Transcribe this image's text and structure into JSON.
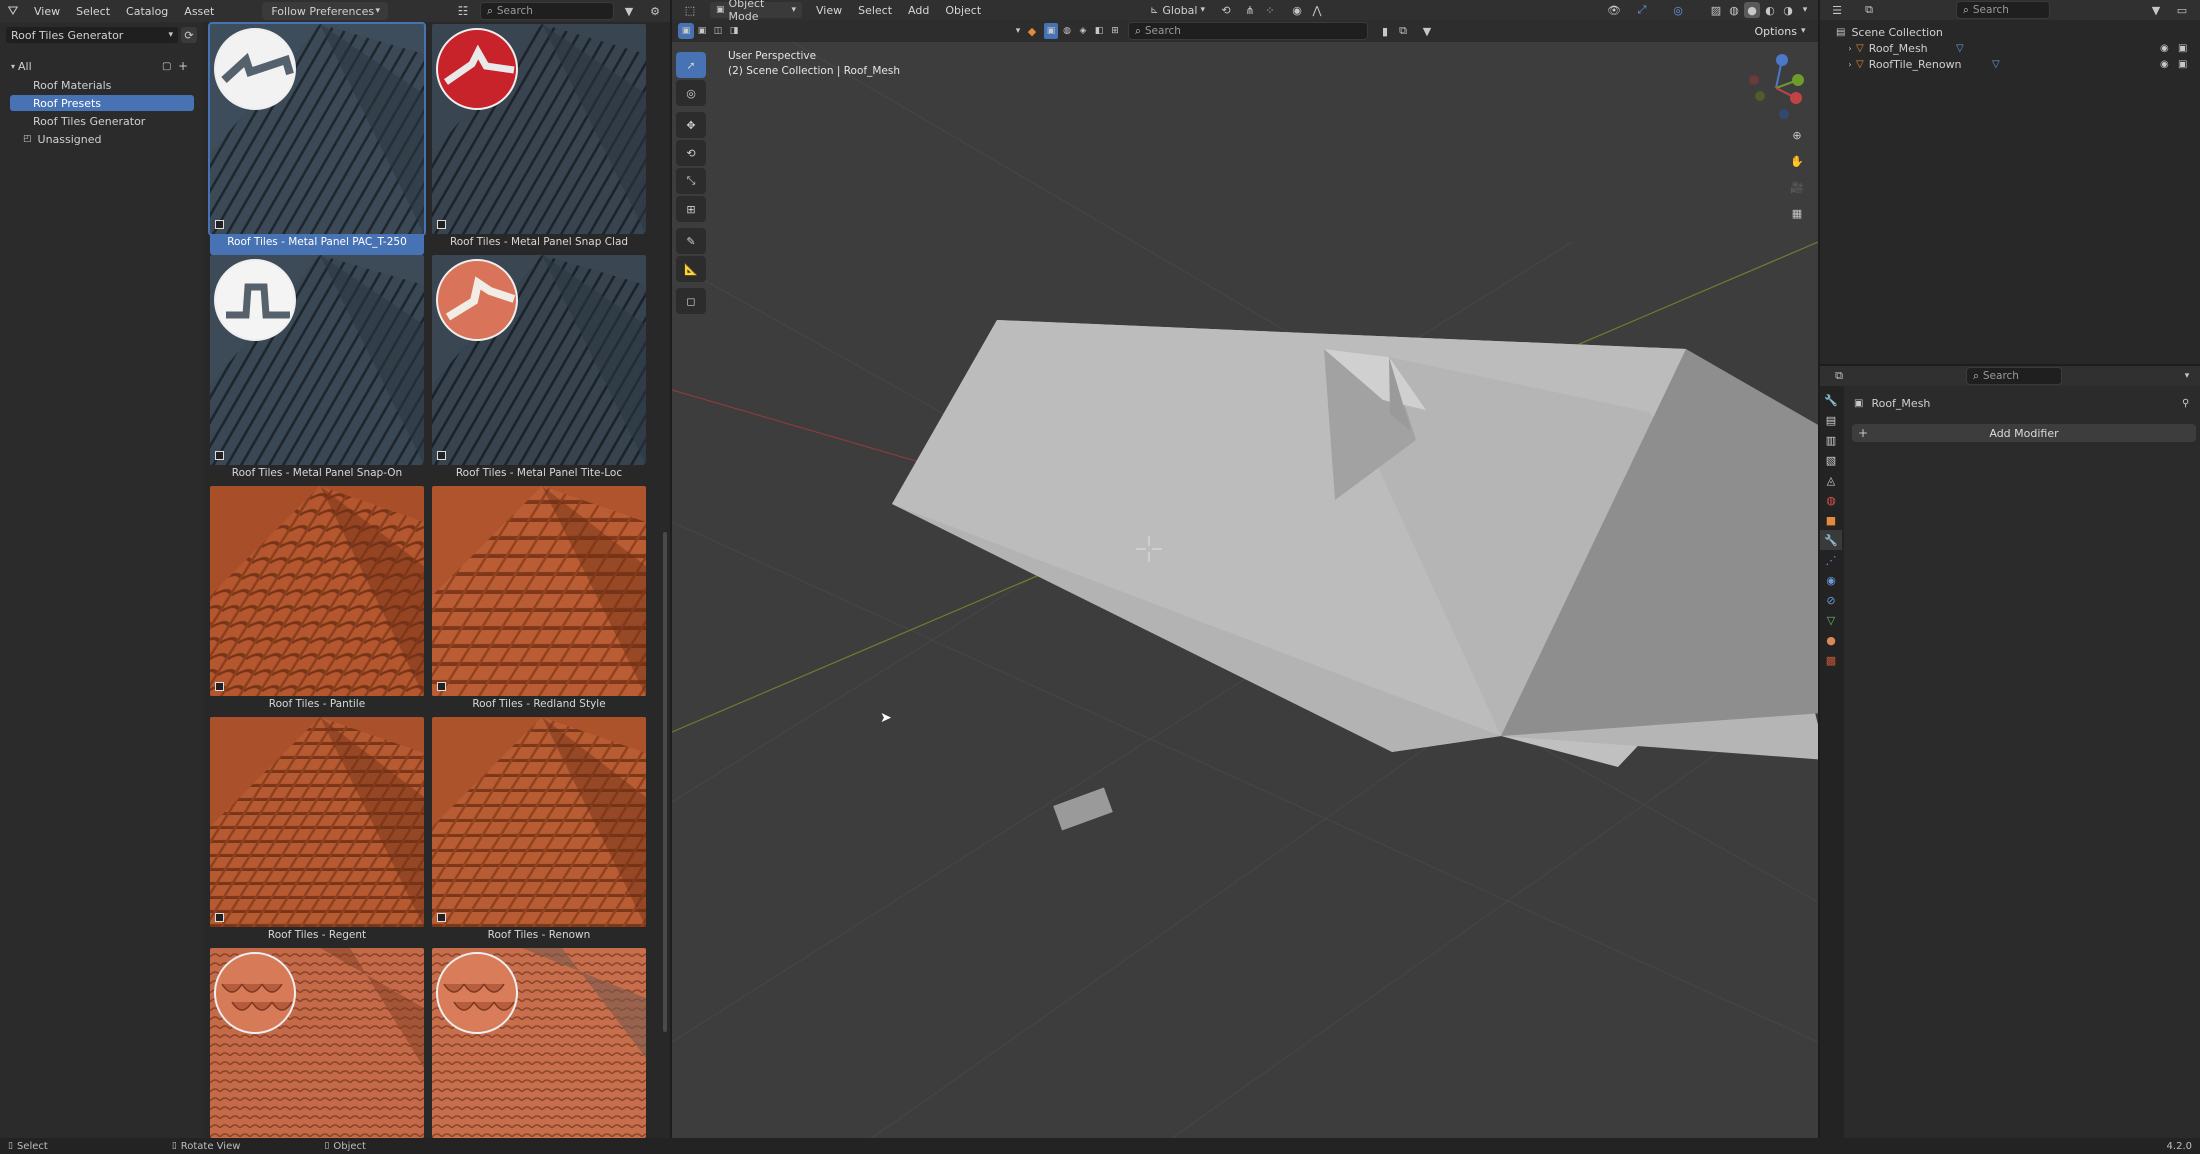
{
  "asset_browser": {
    "menu": [
      "View",
      "Select",
      "Catalog",
      "Asset"
    ],
    "import_method": "Follow Preferences",
    "library": "Roof Tiles Generator",
    "search_placeholder": "Search",
    "catalog_tree": {
      "root": "All",
      "items": [
        "Roof Materials",
        "Roof Presets",
        "Roof Tiles Generator",
        "Unassigned"
      ],
      "selected": "Roof Presets"
    },
    "assets": [
      {
        "label": "Roof Tiles - Metal Panel PAC_T-250",
        "kind": "metal",
        "badge": "white"
      },
      {
        "label": "Roof Tiles - Metal Panel Snap Clad",
        "kind": "metal",
        "badge": "red"
      },
      {
        "label": "Roof Tiles - Metal Panel Snap-On",
        "kind": "metal",
        "badge": "white2"
      },
      {
        "label": "Roof Tiles - Metal Panel Tite-Loc",
        "kind": "metal",
        "badge": "orange"
      },
      {
        "label": "Roof Tiles - Pantile",
        "kind": "tile",
        "badge": ""
      },
      {
        "label": "Roof Tiles - Redland Style",
        "kind": "tile",
        "badge": ""
      },
      {
        "label": "Roof Tiles - Regent",
        "kind": "tile",
        "badge": ""
      },
      {
        "label": "Roof Tiles - Renown",
        "kind": "tile",
        "badge": ""
      },
      {
        "label": "",
        "kind": "shingle",
        "badge": "shingle"
      },
      {
        "label": "",
        "kind": "shingle",
        "badge": "shingle"
      }
    ]
  },
  "viewport": {
    "mode": "Object Mode",
    "menu": [
      "View",
      "Select",
      "Add",
      "Object"
    ],
    "orientation": "Global",
    "search_placeholder": "Search",
    "options_label": "Options",
    "overlay_title": "User Perspective",
    "overlay_subtitle": "(2) Scene Collection | Roof_Mesh"
  },
  "outliner": {
    "search_placeholder": "Search",
    "root": "Scene Collection",
    "items": [
      "Roof_Mesh",
      "RoofTile_Renown"
    ]
  },
  "properties": {
    "search_placeholder": "Search",
    "object_name": "Roof_Mesh",
    "add_modifier": "Add Modifier"
  },
  "statusbar": {
    "select": "Select",
    "rotate": "Rotate View",
    "object": "Object",
    "version": "4.2.0"
  },
  "colors": {
    "accent": "#4772b3",
    "panel": "#303030",
    "viewport_bg": "#3d3d3d"
  }
}
